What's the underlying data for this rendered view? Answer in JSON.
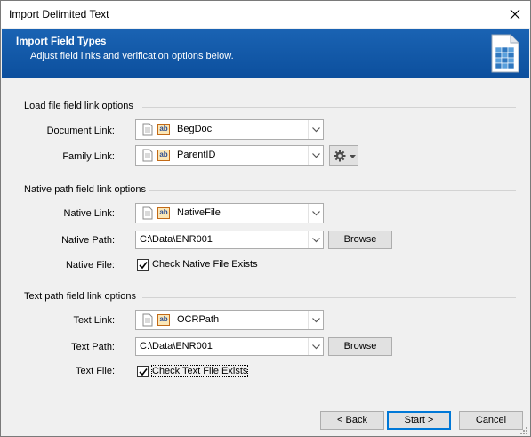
{
  "window": {
    "title": "Import Delimited Text"
  },
  "banner": {
    "heading": "Import Field Types",
    "subtitle": "Adjust field links and verification options below."
  },
  "load_section": {
    "title": "Load file field link options",
    "document_link": {
      "label": "Document Link:",
      "value": "BegDoc"
    },
    "family_link": {
      "label": "Family Link:",
      "value": "ParentID"
    }
  },
  "native_section": {
    "title": "Native path field link options",
    "native_link": {
      "label": "Native Link:",
      "value": "NativeFile"
    },
    "native_path": {
      "label": "Native Path:",
      "value": "C:\\Data\\ENR001",
      "browse": "Browse"
    },
    "native_file": {
      "label": "Native File:",
      "checkbox": "Check Native File Exists",
      "checked": true
    }
  },
  "text_section": {
    "title": "Text path field link options",
    "text_link": {
      "label": "Text Link:",
      "value": "OCRPath"
    },
    "text_path": {
      "label": "Text Path:",
      "value": "C:\\Data\\ENR001",
      "browse": "Browse"
    },
    "text_file": {
      "label": "Text File:",
      "checkbox": "Check Text File Exists",
      "checked": true
    }
  },
  "footer": {
    "back": "< Back",
    "start": "Start >",
    "cancel": "Cancel"
  },
  "colors": {
    "banner": "#0c4f9d",
    "accent": "#0078d7",
    "field_icon_border": "#c36a17"
  }
}
